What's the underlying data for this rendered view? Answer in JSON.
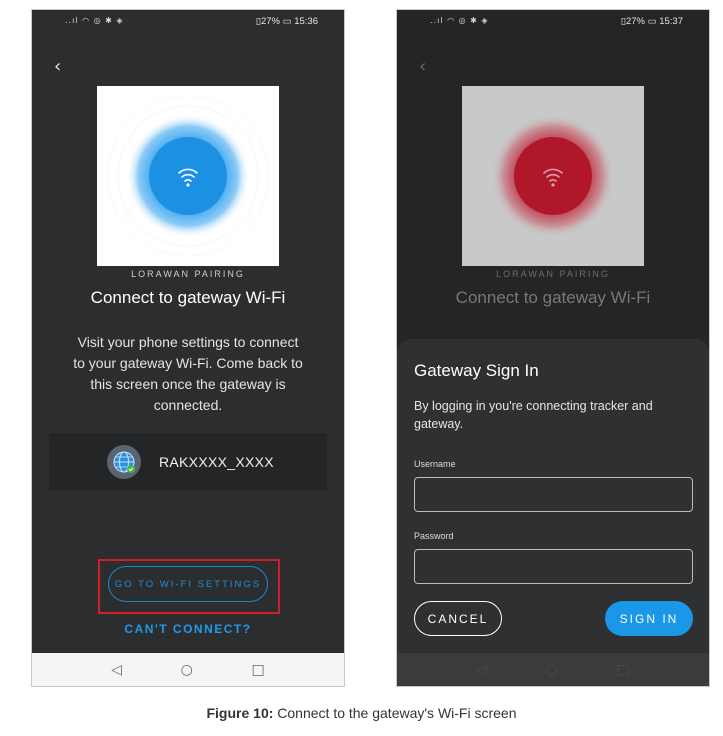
{
  "screen1": {
    "status_left": "..ıl ◠ ◎ ✱ ◈",
    "status_right": "▯27% ▭ 15:36",
    "back_icon": "‹",
    "section_label": "LORAWAN PAIRING",
    "title": "Connect to gateway Wi-Fi",
    "description": "Visit your phone settings to connect to your gateway Wi-Fi. Come back to this screen once the gateway is connected.",
    "network_name": "RAKXXXX_XXXX",
    "settings_button": "GO TO WI-FI SETTINGS",
    "cant_connect_link": "CAN'T CONNECT?",
    "nav": {
      "back": "◁",
      "home": "○",
      "recents": "□"
    },
    "accent_color": "#1a8fe0",
    "highlight_color": "#d21f25"
  },
  "screen2": {
    "status_left": "..ıl ◠ ◎ ✱ ◈",
    "status_right": "▯27% ▭ 15:37",
    "back_icon": "‹",
    "section_label": "LORAWAN PAIRING",
    "title": "Connect to gateway Wi-Fi",
    "sheet_title": "Gateway Sign In",
    "sheet_description": "By logging in you're connecting tracker and gateway.",
    "username_label": "Username",
    "password_label": "Password",
    "cancel_button": "CANCEL",
    "signin_button": "SIGN IN",
    "nav": {
      "back": "◁",
      "home": "○",
      "recents": "□"
    },
    "accent_color": "#1a97e6"
  },
  "caption": {
    "label": "Figure 10:",
    "text": " Connect to the gateway's Wi-Fi screen"
  }
}
